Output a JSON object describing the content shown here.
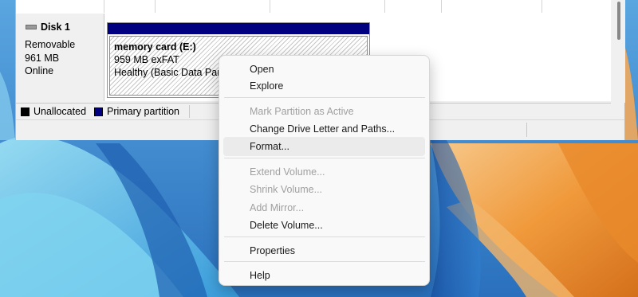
{
  "disk": {
    "title": "Disk 1",
    "type": "Removable",
    "size": "961 MB",
    "status": "Online"
  },
  "partition": {
    "name": "memory card  (E:)",
    "size_fs": "959 MB exFAT",
    "health": "Healthy (Basic Data Partition)"
  },
  "legend": {
    "unallocated": "Unallocated",
    "primary": "Primary partition",
    "unallocated_color": "#000000",
    "primary_color": "#000080"
  },
  "context_menu": {
    "items": [
      {
        "label": "Open",
        "enabled": true
      },
      {
        "label": "Explore",
        "enabled": true
      },
      {
        "label": "Mark Partition as Active",
        "enabled": false
      },
      {
        "label": "Change Drive Letter and Paths...",
        "enabled": true
      },
      {
        "label": "Format...",
        "enabled": true,
        "hovered": true
      },
      {
        "label": "Extend Volume...",
        "enabled": false
      },
      {
        "label": "Shrink Volume...",
        "enabled": false
      },
      {
        "label": "Add Mirror...",
        "enabled": false
      },
      {
        "label": "Delete Volume...",
        "enabled": true
      },
      {
        "label": "Properties",
        "enabled": true
      },
      {
        "label": "Help",
        "enabled": true
      }
    ]
  },
  "icons": {
    "disk": "removable-disk-icon"
  }
}
